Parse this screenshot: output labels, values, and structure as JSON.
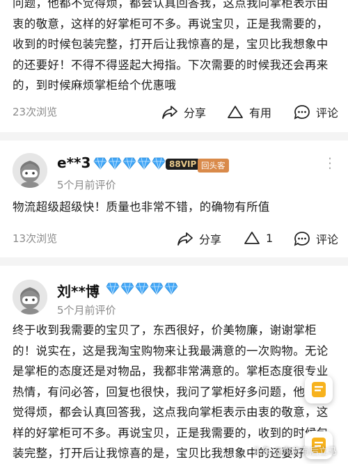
{
  "review_top": {
    "text": "问题，他都不觉得烦，都会认真回答我，这点我向掌柜表示由衷的敬意，这样的好掌柜可不多。再说宝贝，正是我需要的，收到的时候包装完整，打开后让我惊喜的是，宝贝比我想象中的还要好！不得不得竖起大拇指。下次需要的时候我还会再来的，到时候麻烦掌柜给个优惠哦",
    "views": "23次浏览",
    "share": "分享",
    "useful": "有用",
    "comment": "评论"
  },
  "review_2": {
    "username": "e**3",
    "vip": "88VIP",
    "tag": "回头客",
    "time": "5个月前评价",
    "text": "物流超级超级快！质量也非常不错，的确物有所值",
    "views": "13次浏览",
    "share": "分享",
    "useful_count": "1",
    "comment": "评论"
  },
  "review_3": {
    "username": "刘**博",
    "time": "5个月前评价",
    "text": "终于收到我需要的宝贝了，东西很好，价美物廉，谢谢掌柜的！说实在，这是我淘宝购物来让我最满意的一次购物。无论是掌柜的态度还是对物品，我都非常满意的。掌柜态度很专业热情，有问必答，回复也很快，我问了掌柜好多问题，他都不觉得烦，都会认真回答我，这点我向掌柜表示由衷的敬意，这样的好掌柜可不多。再说宝贝，正是我需要的，收到的时候包装完整，打开后让我惊喜的是，宝贝比我想象中的还要好！不得不得竖起大拇指。下次需"
  },
  "watermark": "头条 @东方有后立马",
  "colors": {
    "diamond": "#41a6f7",
    "separator": "#f4f4f4",
    "muted": "#8a8a8a"
  },
  "icons": [
    "share-icon",
    "useful-icon",
    "comment-icon",
    "more-icon",
    "diamond-icon",
    "avatar-icon",
    "float-button-icon"
  ]
}
